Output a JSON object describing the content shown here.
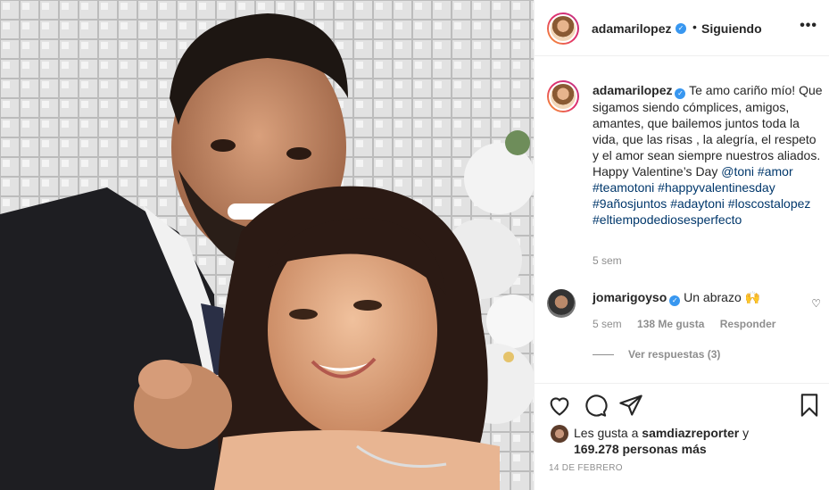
{
  "post": {
    "username": "adamarilopez",
    "follow_state": "Siguiendo",
    "more_label": "•••",
    "caption_text": "Te amo cariño mío! Que sigamos siendo cómplices, amigos, amantes, que bailemos juntos toda la vida, que las risas , la alegría, el respeto y el amor sean siempre nuestros aliados. Happy Valentine’s Day",
    "caption_mention": "@toni",
    "caption_tags": [
      "#amor",
      "#teamotoni",
      "#happyvalentinesday",
      "#9añosjuntos",
      "#adaytoni",
      "#loscostalopez",
      "#eltiempodediosesperfecto"
    ],
    "caption_time": "5 sem",
    "date": "14 DE FEBRERO"
  },
  "comment": {
    "username": "jomarigoyso",
    "text": "Un abrazo 🙌",
    "time": "5 sem",
    "likes": "138 Me gusta",
    "reply_label": "Responder",
    "view_replies": "Ver respuestas (3)"
  },
  "likes": {
    "prefix": "Les gusta a",
    "user": "samdiazreporter",
    "joiner": "y",
    "count": "169.278 personas más"
  },
  "icons": [
    "heart-icon",
    "comment-icon",
    "share-icon",
    "bookmark-icon",
    "verified-icon",
    "more-icon"
  ],
  "colors": {
    "link": "#00376b",
    "verified": "#3897f0",
    "meta": "#8e8e8e"
  }
}
